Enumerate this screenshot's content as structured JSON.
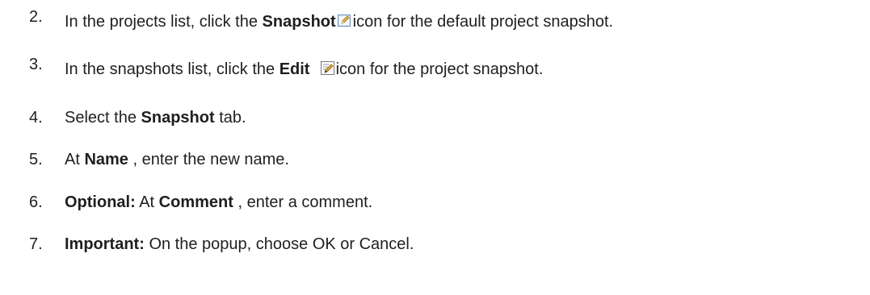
{
  "steps": [
    {
      "number": "2.",
      "before": "In the projects list, click the ",
      "bold": "Snapshot",
      "icon": "snapshot-icon",
      "after": "icon for the default project snapshot."
    },
    {
      "number": "3.",
      "before": "In the snapshots list, click the ",
      "bold": "Edit",
      "icon": "edit-icon",
      "after": "icon for the project snapshot."
    },
    {
      "number": "4.",
      "before": "Select the ",
      "bold": "Snapshot",
      "after": " tab."
    },
    {
      "number": "5.",
      "before": "At ",
      "bold": "Name",
      "after": " , enter the new name."
    },
    {
      "number": "6.",
      "lead_bold": "Optional:",
      "before": " At ",
      "bold": "Comment",
      "after": " , enter a comment."
    },
    {
      "number": "7.",
      "lead_bold": "Important:",
      "after": " On the popup, choose OK or Cancel."
    }
  ]
}
